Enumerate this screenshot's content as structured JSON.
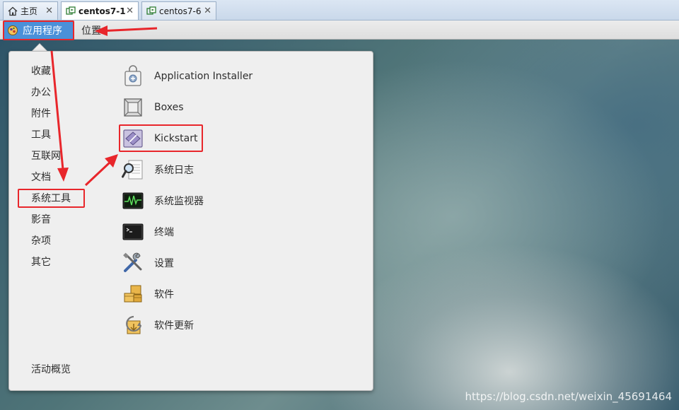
{
  "tabs": [
    {
      "label": "主页",
      "icon": "home-icon",
      "active": false
    },
    {
      "label": "centos7-1",
      "icon": "vm-icon",
      "active": true
    },
    {
      "label": "centos7-6",
      "icon": "vm-icon",
      "active": false
    }
  ],
  "tab_close": "✕",
  "topbar": {
    "applications_label": "应用程序",
    "places_label": "位置"
  },
  "menu": {
    "categories": [
      "收藏",
      "办公",
      "附件",
      "工具",
      "互联网",
      "文档",
      "系统工具",
      "影音",
      "杂项",
      "其它"
    ],
    "selected_category": "系统工具",
    "activities_label": "活动概览",
    "apps": [
      {
        "label": "Application Installer",
        "icon": "application-installer-icon"
      },
      {
        "label": "Boxes",
        "icon": "boxes-icon"
      },
      {
        "label": "Kickstart",
        "icon": "kickstart-icon"
      },
      {
        "label": "系统日志",
        "icon": "system-log-icon"
      },
      {
        "label": "系统监视器",
        "icon": "system-monitor-icon"
      },
      {
        "label": "终端",
        "icon": "terminal-icon"
      },
      {
        "label": "设置",
        "icon": "settings-icon"
      },
      {
        "label": "软件",
        "icon": "software-icon"
      },
      {
        "label": "软件更新",
        "icon": "software-update-icon"
      }
    ],
    "highlighted_app": "Kickstart"
  },
  "watermark": "https://blog.csdn.net/weixin_45691464",
  "colors": {
    "annotation": "#e8262b",
    "accent": "#4a90d9"
  }
}
